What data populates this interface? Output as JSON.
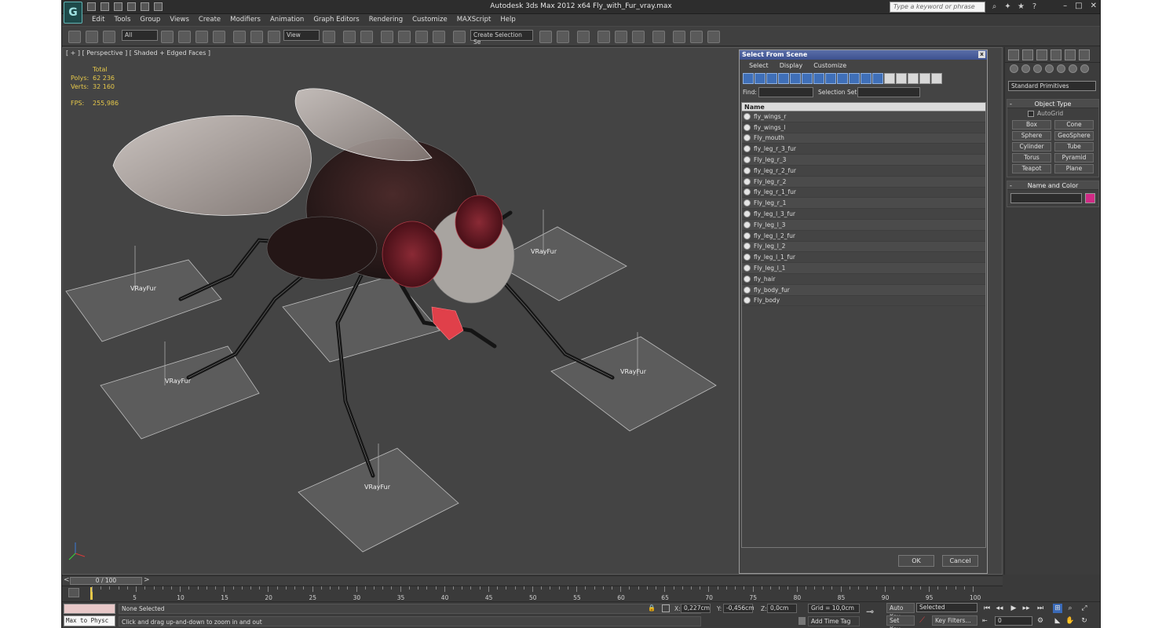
{
  "window": {
    "title": "Autodesk 3ds Max  2012 x64      Fly_with_Fur_vray.max",
    "search_placeholder": "Type a keyword or phrase",
    "logo_text": "G"
  },
  "menu": [
    "Edit",
    "Tools",
    "Group",
    "Views",
    "Create",
    "Modifiers",
    "Animation",
    "Graph Editors",
    "Rendering",
    "Customize",
    "MAXScript",
    "Help"
  ],
  "toolbar": {
    "filter_value": "All",
    "coord_system": "View",
    "selection_set": "Create Selection Se"
  },
  "viewport": {
    "label": "[ + ] [ Perspective ] [ Shaded + Edged Faces ]",
    "stats": {
      "header": "Total",
      "polys_label": "Polys:",
      "polys_value": "62 236",
      "verts_label": "Verts:",
      "verts_value": "32 160",
      "fps_label": "FPS:",
      "fps_value": "255,986"
    },
    "fur_label": "VRayFur"
  },
  "select_dialog": {
    "title": "Select From Scene",
    "close": "x",
    "menu": [
      "Select",
      "Display",
      "Customize"
    ],
    "find_label": "Find:",
    "selection_set_label": "Selection Set:",
    "column_name": "Name",
    "items": [
      "fly_wings_r",
      "fly_wings_l",
      "Fly_mouth",
      "fly_leg_r_3_fur",
      "Fly_leg_r_3",
      "fly_leg_r_2_fur",
      "Fly_leg_r_2",
      "fly_leg_r_1_fur",
      "Fly_leg_r_1",
      "fly_leg_l_3_fur",
      "Fly_leg_l_3",
      "fly_leg_l_2_fur",
      "Fly_leg_l_2",
      "fly_leg_l_1_fur",
      "Fly_leg_l_1",
      "fly_hair",
      "fly_body_fur",
      "Fly_body"
    ],
    "ok_label": "OK",
    "cancel_label": "Cancel"
  },
  "command_panel": {
    "category": "Standard Primitives",
    "object_type_title": "Object Type",
    "autogrid_label": "AutoGrid",
    "primitives": [
      "Box",
      "Cone",
      "Sphere",
      "GeoSphere",
      "Cylinder",
      "Tube",
      "Torus",
      "Pyramid",
      "Teapot",
      "Plane"
    ],
    "name_color_title": "Name and Color",
    "color": "#d12a86"
  },
  "timeline": {
    "slider_text": "0 / 100",
    "prev_arrow": "<",
    "next_arrow": ">",
    "ticks": [
      "5",
      "10",
      "15",
      "20",
      "25",
      "30",
      "35",
      "40",
      "45",
      "50",
      "55",
      "60",
      "65",
      "70",
      "75",
      "80",
      "85",
      "90",
      "95",
      "100"
    ]
  },
  "status": {
    "maxscript_text": "Max to Physc",
    "selection": "None Selected",
    "prompt": "Click and drag up-and-down to zoom in and out",
    "x_label": "X:",
    "x_value": "0,227cm",
    "y_label": "Y:",
    "y_value": "-0,456cm",
    "z_label": "Z:",
    "z_value": "0,0cm",
    "grid": "Grid = 10,0cm",
    "add_time_tag": "Add Time Tag",
    "auto_key": "Auto Key",
    "set_key": "Set Key",
    "selected_value": "Selected",
    "key_filters": "Key Filters...",
    "frame_value": "0"
  }
}
